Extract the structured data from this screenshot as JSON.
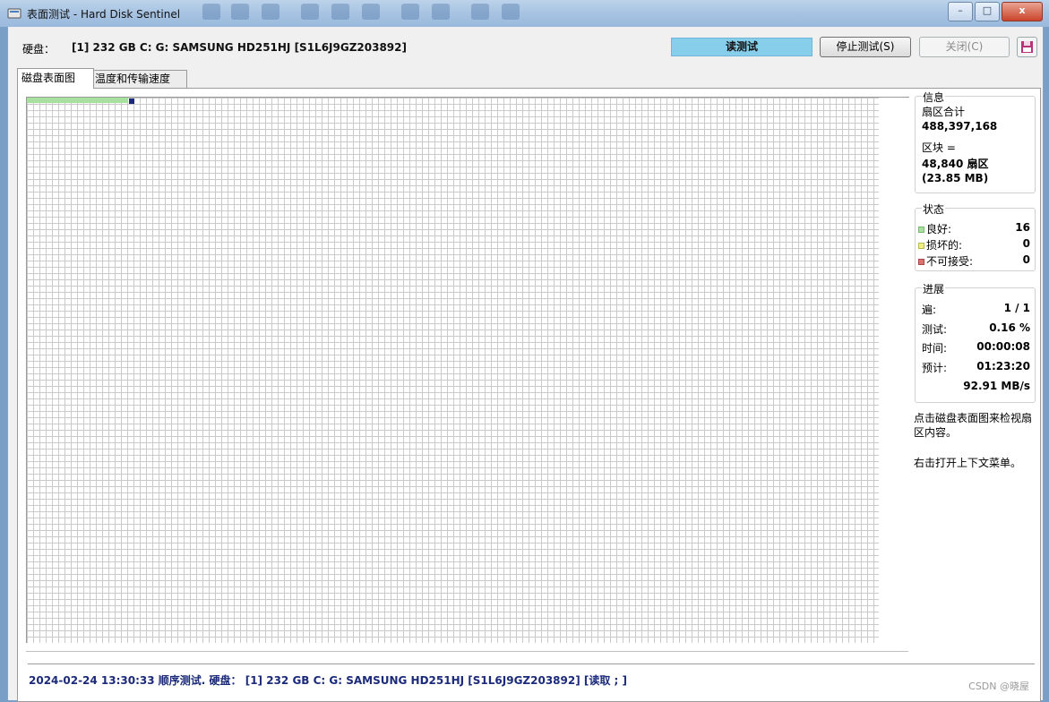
{
  "window": {
    "title": "表面测试 - Hard Disk Sentinel",
    "minimize_label": "–",
    "maximize_label": "□",
    "close_label": "x"
  },
  "header": {
    "disk_label": "硬盘：",
    "disk_value": "[1] 232 GB C: G: SAMSUNG HD251HJ [S1L6J9GZ203892]",
    "mode_badge": "读测试",
    "stop_button": "停止测试(S)",
    "close_button": "关闭(C)"
  },
  "tabs": [
    {
      "label": "磁盘表面图",
      "active": true
    },
    {
      "label": "温度和传输速度",
      "active": false
    }
  ],
  "info": {
    "title": "信息",
    "total_sectors_label": "扇区合计",
    "total_sectors_value": "488,397,168",
    "block_label": "区块 =",
    "block_value": "48,840 扇区",
    "block_size": "(23.85 MB)"
  },
  "status": {
    "title": "状态",
    "good_label": "良好:",
    "good_value": "16",
    "damaged_label": "损坏的:",
    "damaged_value": "0",
    "unacceptable_label": "不可接受:",
    "unacceptable_value": "0"
  },
  "progress": {
    "title": "进展",
    "pass_label": "遍:",
    "pass_value": "1 / 1",
    "tested_label": "测试:",
    "tested_value": "0.16 %",
    "time_label": "时间:",
    "time_value": "00:00:08",
    "estimate_label": "预计:",
    "estimate_value": "01:23:20",
    "speed_value": "92.91 MB/s"
  },
  "notes": {
    "click_hint": "点击磁盘表面图来检视扇区内容。",
    "right_click_hint": "右击打开上下文菜单。"
  },
  "surface_map": {
    "blocks_done": 16,
    "progress_fraction": 0.0016
  },
  "status_bar": {
    "text": "2024-02-24  13:30:33  顺序测试. 硬盘：  [1] 232 GB C: G: SAMSUNG HD251HJ [S1L6J9GZ203892] [读取 ; ]"
  },
  "watermark": "CSDN @晓屋",
  "colors": {
    "good": "#a8e0a0",
    "damaged": "#f0f080",
    "unacceptable": "#e07070",
    "current_block": "#1b2a7a",
    "badge": "#87ceeb"
  },
  "icons": [
    "disk-sentinel-icon",
    "save-icon"
  ]
}
